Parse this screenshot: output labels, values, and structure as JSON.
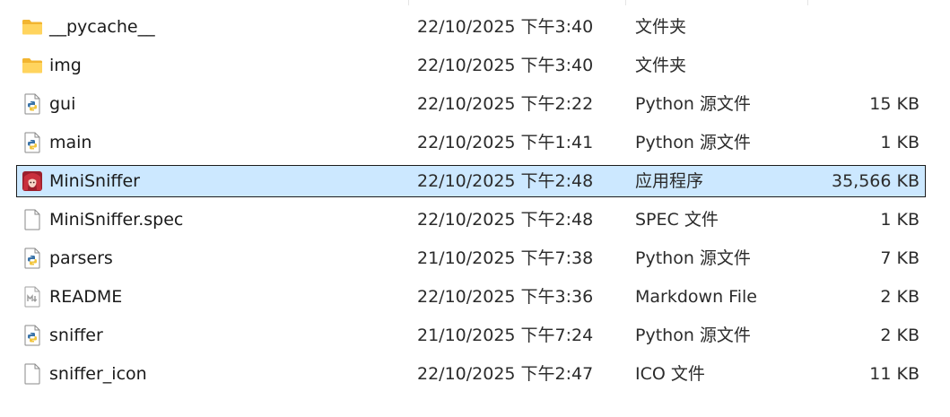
{
  "files": [
    {
      "name": "__pycache__",
      "date": "22/10/2025 下午3:40",
      "type": "文件夹",
      "size": "",
      "icon": "folder-icon",
      "selected": false
    },
    {
      "name": "img",
      "date": "22/10/2025 下午3:40",
      "type": "文件夹",
      "size": "",
      "icon": "folder-icon",
      "selected": false
    },
    {
      "name": "gui",
      "date": "22/10/2025 下午2:22",
      "type": "Python 源文件",
      "size": "15 KB",
      "icon": "python-file-icon",
      "selected": false
    },
    {
      "name": "main",
      "date": "22/10/2025 下午1:41",
      "type": "Python 源文件",
      "size": "1 KB",
      "icon": "python-file-icon",
      "selected": false
    },
    {
      "name": "MiniSniffer",
      "date": "22/10/2025 下午2:48",
      "type": "应用程序",
      "size": "35,566 KB",
      "icon": "app-icon",
      "selected": true
    },
    {
      "name": "MiniSniffer.spec",
      "date": "22/10/2025 下午2:48",
      "type": "SPEC 文件",
      "size": "1 KB",
      "icon": "blank-file-icon",
      "selected": false
    },
    {
      "name": "parsers",
      "date": "21/10/2025 下午7:38",
      "type": "Python 源文件",
      "size": "7 KB",
      "icon": "python-file-icon",
      "selected": false
    },
    {
      "name": "README",
      "date": "22/10/2025 下午3:36",
      "type": "Markdown File",
      "size": "2 KB",
      "icon": "markdown-file-icon",
      "selected": false
    },
    {
      "name": "sniffer",
      "date": "21/10/2025 下午7:24",
      "type": "Python 源文件",
      "size": "2 KB",
      "icon": "python-file-icon",
      "selected": false
    },
    {
      "name": "sniffer_icon",
      "date": "22/10/2025 下午2:47",
      "type": "ICO 文件",
      "size": "11 KB",
      "icon": "blank-file-icon",
      "selected": false
    }
  ],
  "colors": {
    "selection_fill": "#cce8ff",
    "selection_border": "#1c1c1c",
    "folder": "#f8c63a",
    "python_blue": "#3a73a8"
  }
}
